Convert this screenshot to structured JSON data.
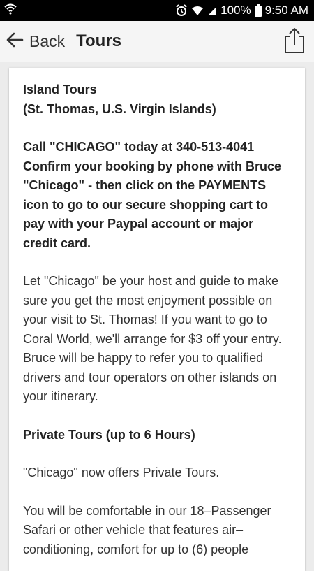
{
  "status_bar": {
    "battery": "100%",
    "time": "9:50 AM",
    "icons": [
      "wifi-icon",
      "alarm-icon",
      "wifi-icon",
      "signal-icon",
      "battery-icon"
    ]
  },
  "app_bar": {
    "back_label": "Back",
    "title": "Tours",
    "share_icon": "share-icon"
  },
  "content": {
    "heading_line1": "Island Tours",
    "heading_line2": "(St. Thomas, U.S. Virgin Islands)",
    "call_text": "Call \"CHICAGO\" today at 340-513-4041 Confirm your booking by phone with Bruce \"Chicago\" - then click on the PAYMENTS icon to go to our secure shopping cart to pay with your Paypal account or major credit card.",
    "intro_text": "Let \"Chicago\" be your host and guide to make sure you get the most enjoyment possible on your visit to St. Thomas! If you want to go to Coral World, we'll arrange for $3 off your entry. Bruce will be happy to refer you to qualified drivers and tour operators on other islands on your itinerary.",
    "private_heading": "Private Tours (up to 6 Hours)",
    "private_text": "\"Chicago\" now offers Private Tours.",
    "vehicle_text": "You will be comfortable in our 18–Passenger Safari or other vehicle that features air–conditioning, comfort for up to (6) people"
  }
}
